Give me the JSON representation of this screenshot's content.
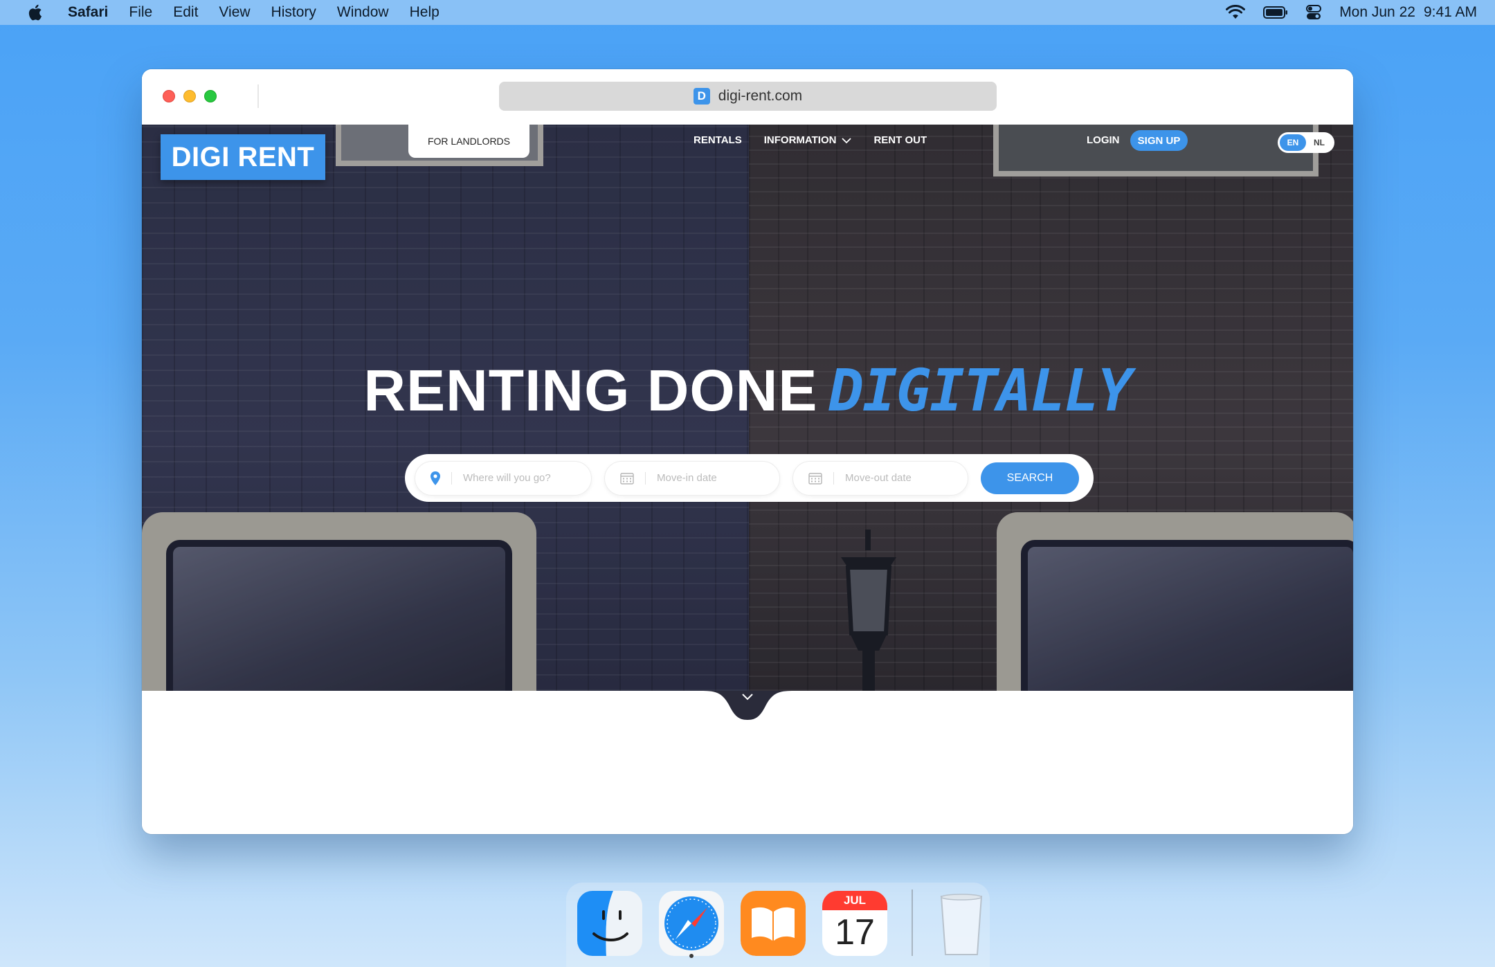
{
  "menubar": {
    "app_name": "Safari",
    "items": [
      "File",
      "Edit",
      "View",
      "History",
      "Window",
      "Help"
    ],
    "date": "Mon Jun 22",
    "time": "9:41 AM",
    "status_icons": [
      "wifi-icon",
      "battery-icon",
      "control-center-icon"
    ]
  },
  "browser": {
    "url": "digi-rent.com",
    "favicon_letter": "D"
  },
  "site": {
    "logo": "DIGI RENT",
    "landlords_tab": "FOR LANDLORDS",
    "nav": {
      "rentals": "RENTALS",
      "information": "INFORMATION",
      "rent_out": "RENT OUT"
    },
    "login": "LOGIN",
    "signup": "SIGN UP",
    "lang": {
      "en": "EN",
      "nl": "NL",
      "active": "EN"
    },
    "headline": "RENTING DONE",
    "headline_accent": "DIGITALLY",
    "search": {
      "location_placeholder": "Where will you go?",
      "move_in_placeholder": "Move-in date",
      "move_out_placeholder": "Move-out date",
      "button": "SEARCH"
    },
    "accent_color": "#3d94ea"
  },
  "dock": {
    "apps": [
      "finder-icon",
      "safari-icon",
      "books-icon",
      "calendar-icon",
      "trash-icon"
    ],
    "calendar_month": "JUL",
    "calendar_day": "17"
  }
}
